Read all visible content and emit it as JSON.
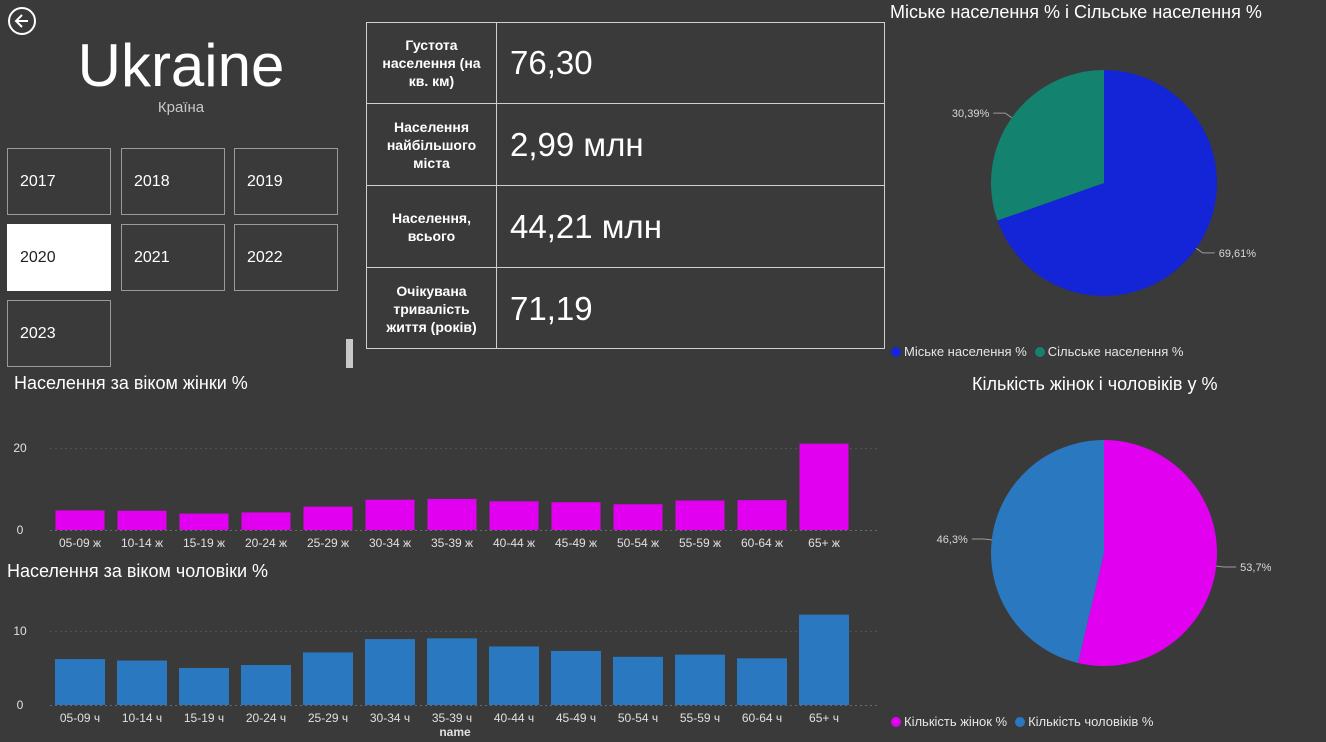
{
  "header": {
    "back_icon": "back-arrow-icon",
    "country": "Ukraine",
    "country_caption": "Країна"
  },
  "years": {
    "items": [
      "2017",
      "2018",
      "2019",
      "2020",
      "2021",
      "2022",
      "2023"
    ],
    "selected": "2020"
  },
  "kpis": [
    {
      "label": "Густота населення (на кв. км)",
      "value": "76,30"
    },
    {
      "label": "Населення найбільшого міста",
      "value": "2,99 млн"
    },
    {
      "label": "Населення, всього",
      "value": "44,21 млн"
    },
    {
      "label": "Очікувана тривалість життя (років)",
      "value": "71,19"
    }
  ],
  "colors": {
    "background": "#3a3a3a",
    "urban": "#1325d6",
    "rural": "#13826f",
    "women": "#e100f0",
    "men": "#2a78c0"
  },
  "chart_data": [
    {
      "type": "pie",
      "title": "Міське населення % і Сільське населення %",
      "labels": [
        "Міське населення %",
        "Сільське населення %"
      ],
      "values": [
        69.61,
        30.39
      ],
      "data_labels": [
        "69,61%",
        "30,39%"
      ],
      "legend": "bottom-left"
    },
    {
      "type": "bar",
      "title": "Населення за віком жінки %",
      "categories": [
        "05-09 ж",
        "10-14 ж",
        "15-19 ж",
        "20-24 ж",
        "25-29 ж",
        "30-34 ж",
        "35-39 ж",
        "40-44 ж",
        "45-49 ж",
        "50-54 ж",
        "55-59 ж",
        "60-64 ж",
        "65+ ж"
      ],
      "values": [
        4.8,
        4.7,
        4.0,
        4.3,
        5.7,
        7.4,
        7.6,
        7.0,
        6.8,
        6.3,
        7.2,
        7.3,
        21.1
      ],
      "yticks": [
        "0",
        "20"
      ],
      "ylim": [
        0,
        22
      ],
      "grid": true
    },
    {
      "type": "bar",
      "title": "Населення за віком чоловіки %",
      "categories": [
        "05-09 ч",
        "10-14 ч",
        "15-19 ч",
        "20-24 ч",
        "25-29 ч",
        "30-34 ч",
        "35-39 ч",
        "40-44 ч",
        "45-49 ч",
        "50-54 ч",
        "55-59 ч",
        "60-64 ч",
        "65+ ч"
      ],
      "values": [
        6.2,
        6.0,
        5.0,
        5.4,
        7.1,
        8.9,
        9.0,
        7.9,
        7.3,
        6.5,
        6.8,
        6.3,
        12.2
      ],
      "yticks": [
        "0",
        "10"
      ],
      "ylim": [
        0,
        13.5
      ],
      "xlabel": "name",
      "grid": true
    },
    {
      "type": "pie",
      "title": "Кількість жінок і чоловіків у %",
      "labels": [
        "Кількість жінок %",
        "Кількість чоловіків %"
      ],
      "values": [
        53.7,
        46.3
      ],
      "data_labels": [
        "53,7%",
        "46,3%"
      ],
      "legend": "bottom-left"
    }
  ]
}
